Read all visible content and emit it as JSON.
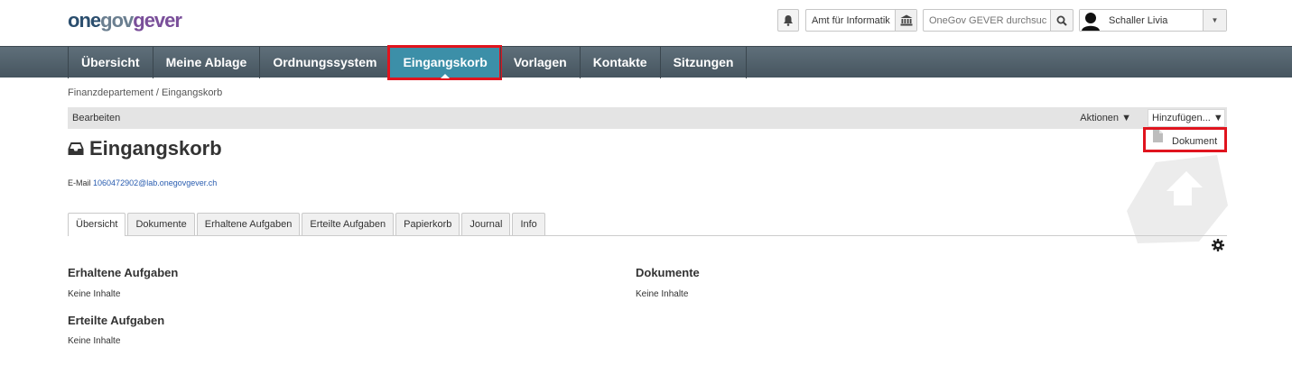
{
  "logo": {
    "part1": "one",
    "part2": "gov",
    "part3": "gever"
  },
  "header": {
    "notification_icon": "bell-icon",
    "org_label": "Amt für Informatik",
    "org_icon": "bank-icon",
    "search_placeholder": "OneGov GEVER durchsuc",
    "search_icon": "search-icon",
    "user_name": "Schaller Livia"
  },
  "nav": {
    "items": [
      "Übersicht",
      "Meine Ablage",
      "Ordnungssystem",
      "Eingangskorb",
      "Vorlagen",
      "Kontakte",
      "Sitzungen"
    ],
    "active": "Eingangskorb"
  },
  "breadcrumb": "Finanzdepartement / Eingangskorb",
  "actionbar": {
    "edit": "Bearbeiten",
    "actions": "Aktionen ▼",
    "add": "Hinzufügen... ▼"
  },
  "dropdown": {
    "item": "Dokument"
  },
  "page": {
    "title": "Eingangskorb",
    "email_label": "E-Mail",
    "email": "1060472902@lab.onegovgever.ch"
  },
  "tabs": [
    "Übersicht",
    "Dokumente",
    "Erhaltene Aufgaben",
    "Erteilte Aufgaben",
    "Papierkorb",
    "Journal",
    "Info"
  ],
  "sections": {
    "received": {
      "title": "Erhaltene Aufgaben",
      "text": "Keine Inhalte"
    },
    "documents": {
      "title": "Dokumente",
      "text": "Keine Inhalte"
    },
    "issued": {
      "title": "Erteilte Aufgaben",
      "text": "Keine Inhalte"
    }
  },
  "colors": {
    "nav_active": "#3c8fa8",
    "highlight": "#e0141e",
    "link": "#2a5db0"
  }
}
